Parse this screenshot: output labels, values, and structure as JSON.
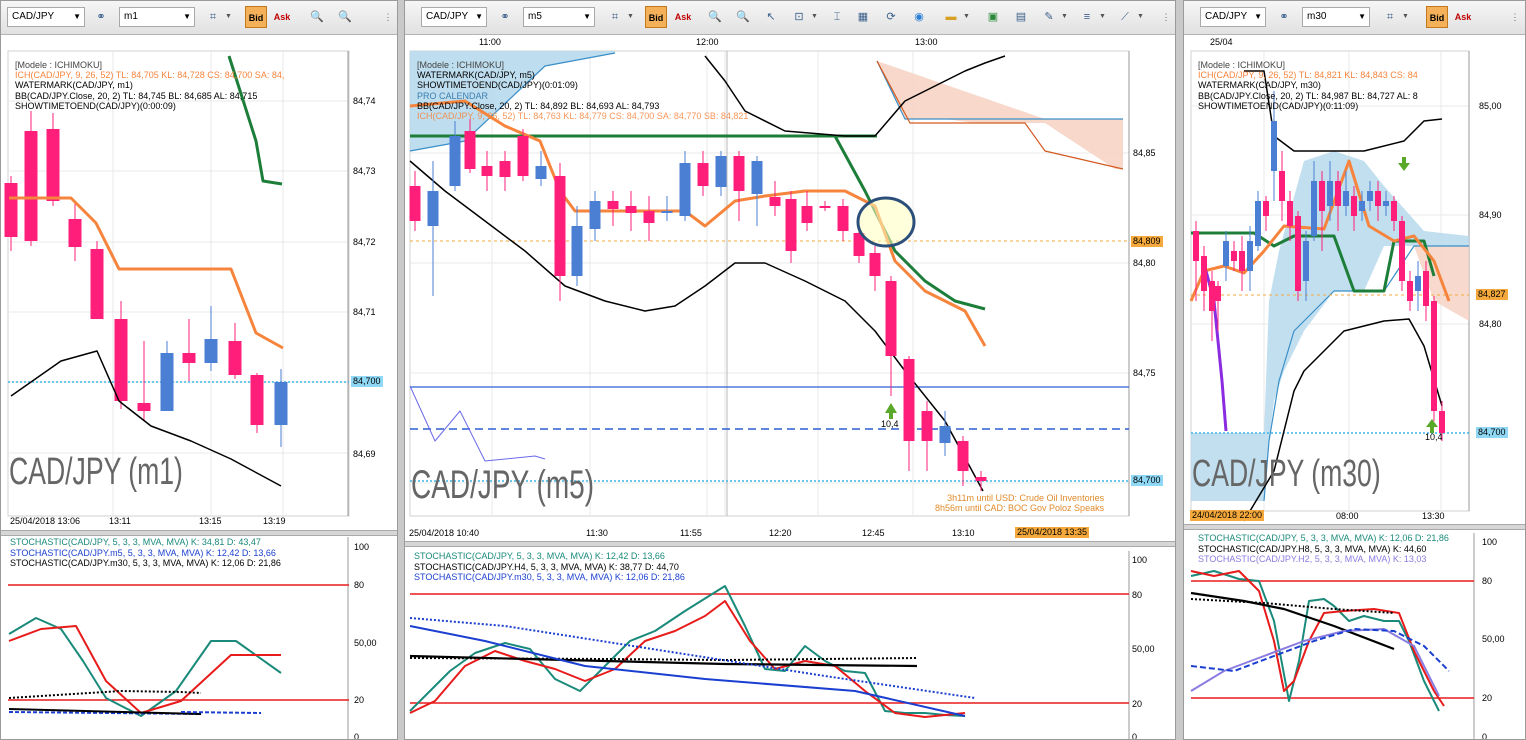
{
  "common": {
    "symbol": "CAD/JPY",
    "bid": "Bid",
    "ask": "Ask"
  },
  "left": {
    "timeframe": "m1",
    "info": [
      "[Modele : ICHIMOKU]",
      "ICH(CAD/JPY, 9, 26, 52)  TL: 84,705  KL: 84,728  CS: 84,700  SA: 84,",
      "WATERMARK(CAD/JPY, m1)",
      "BB(CAD/JPY.Close, 20, 2)  TL: 84,745  BL: 84,685  AL: 84,715",
      "SHOWTIMETOEND(CAD/JPY)(0:00:09)"
    ],
    "prices": [
      "84,74",
      "84,73",
      "84,72",
      "84,71",
      "84,70",
      "84,69"
    ],
    "last_price": "84,700",
    "times": [
      "25/04/2018 13:06",
      "13:11",
      "13:15",
      "13:19"
    ],
    "watermark": "CAD/JPY (m1)",
    "stoch": [
      "STOCHASTIC(CAD/JPY, 5, 3, 3, MVA, MVA)  K: 34,81  D: 43,47",
      "STOCHASTIC(CAD/JPY.m5, 5, 3, 3, MVA, MVA)  K: 12,42  D: 13,66",
      "STOCHASTIC(CAD/JPY.m30, 5, 3, 3, MVA, MVA)  K: 12,06  D: 21,86"
    ],
    "stoch_levels": [
      "100",
      "80",
      "50,00",
      "20",
      "0"
    ]
  },
  "middle": {
    "timeframe": "m5",
    "top_times": [
      "11:00",
      "12:00",
      "13:00"
    ],
    "info": [
      "[Modele : ICHIMOKU]",
      "WATERMARK(CAD/JPY, m5)",
      "SHOWTIMETOEND(CAD/JPY)(0:01:09)",
      "PRO CALENDAR",
      "BB(CAD/JPY.Close, 20, 2)  TL: 84,892  BL: 84,693  AL: 84,793",
      "ICH(CAD/JPY, 9, 26, 52)  TL: 84,763  KL: 84,779  CS: 84,700  SA: 84,770  SB: 84,821"
    ],
    "prices": [
      "84,85",
      "84,80",
      "84,75",
      "84,70"
    ],
    "level_price": "84,809",
    "last_price": "84,700",
    "arrow_label": "10,4",
    "times": [
      "25/04/2018 10:40",
      "11:30",
      "11:55",
      "12:20",
      "12:45",
      "13:10"
    ],
    "current_time": "25/04/2018 13:35",
    "watermark": "CAD/JPY (m5)",
    "events": [
      "3h11m until USD: Crude Oil Inventories",
      "8h56m until CAD: BOC Gov Poloz Speaks"
    ],
    "stoch": [
      "STOCHASTIC(CAD/JPY, 5, 3, 3, MVA, MVA)  K: 12,42  D: 13,66",
      "STOCHASTIC(CAD/JPY.H4, 5, 3, 3, MVA, MVA)  K: 38,77  D: 44,70",
      "STOCHASTIC(CAD/JPY.m30, 5, 3, 3, MVA, MVA)  K: 12,06  D: 21,86"
    ],
    "stoch_levels": [
      "100",
      "80",
      "50,00",
      "20",
      "0"
    ]
  },
  "right": {
    "timeframe": "m30",
    "top_times": [
      "25/04"
    ],
    "info": [
      "[Modele : ICHIMOKU]",
      "ICH(CAD/JPY, 9, 26, 52)  TL: 84,821  KL: 84,843  CS: 84",
      "WATERMARK(CAD/JPY, m30)",
      "BB(CAD/JPY.Close, 20, 2)  TL: 84,987  BL: 84,727  AL: 8",
      "SHOWTIMETOEND(CAD/JPY)(0:11:09)"
    ],
    "prices": [
      "85,00",
      "84,90",
      "84,80"
    ],
    "level_price": "84,827",
    "last_price": "84,700",
    "arrow_label": "10,4",
    "times": [
      "24/04/2018 22:00",
      "08:00",
      "13:30"
    ],
    "watermark": "CAD/JPY (m30)",
    "stoch": [
      "STOCHASTIC(CAD/JPY, 5, 3, 3, MVA, MVA)  K: 12,06  D: 21,86",
      "STOCHASTIC(CAD/JPY.H8, 5, 3, 3, MVA, MVA)  K: 44,60",
      "STOCHASTIC(CAD/JPY.H2, 5, 3, 3, MVA, MVA)  K: 13,03"
    ],
    "stoch_levels": [
      "100",
      "80",
      "50,00",
      "20",
      "0"
    ]
  },
  "colors": {
    "bull": "#4a7fd4",
    "bear": "#ff1f7a",
    "tenkan": "#f6843c",
    "kijun": "#1d7e3a",
    "bb": "#000000",
    "cloud_up": "#b7d9ec",
    "cloud_down": "#f6d4c4",
    "price_line": "#3fb6e8",
    "stoch_k": "#1a8a7a",
    "stoch_d": "#e81b1b",
    "level_red": "#e81b1b",
    "accent": "#f5a93c"
  }
}
